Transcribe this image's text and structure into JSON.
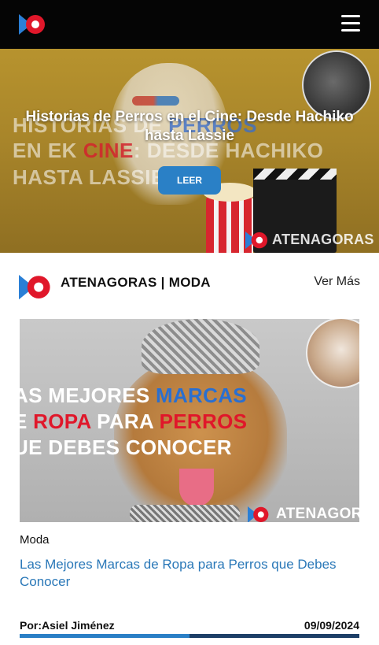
{
  "header": {
    "logo": "atenagoras-logo",
    "menu_icon": "hamburger-menu-icon"
  },
  "hero": {
    "title": "Historias de Perros en el Cine: Desde Hachiko hasta Lassie",
    "button_label": "LEER",
    "image_text": {
      "line1_a": "HISTORIAS DE ",
      "line1_b": "PERROS",
      "line2_a": "EN EK ",
      "line2_b": "CINE",
      "line2_c": ": DESDE HACHIKO",
      "line3": "HASTA LASSIE"
    },
    "watermark": "ATENAGORAS"
  },
  "section": {
    "title": "ATENAGORAS | MODA",
    "see_more": "Ver Más"
  },
  "article": {
    "image_text": {
      "line1_a": "AS MEJORES ",
      "line1_b": "MARCAS",
      "line2_a": "E ",
      "line2_b": "ROPA",
      "line2_c": " PARA ",
      "line2_d": "PERROS",
      "line3": "UE DEBES CONOCER"
    },
    "watermark": "ATENAGOR",
    "category": "Moda",
    "title": "Las Mejores Marcas de Ropa para Perros que Debes Conocer",
    "author_label": "Por:",
    "author_name": "Asiel Jiménez",
    "date": "09/09/2024",
    "progress": 0.5
  },
  "colors": {
    "topbar": "#050505",
    "accent_blue": "#2a80c6",
    "brand_red": "#e0172a",
    "link_blue": "#2a78b8"
  }
}
